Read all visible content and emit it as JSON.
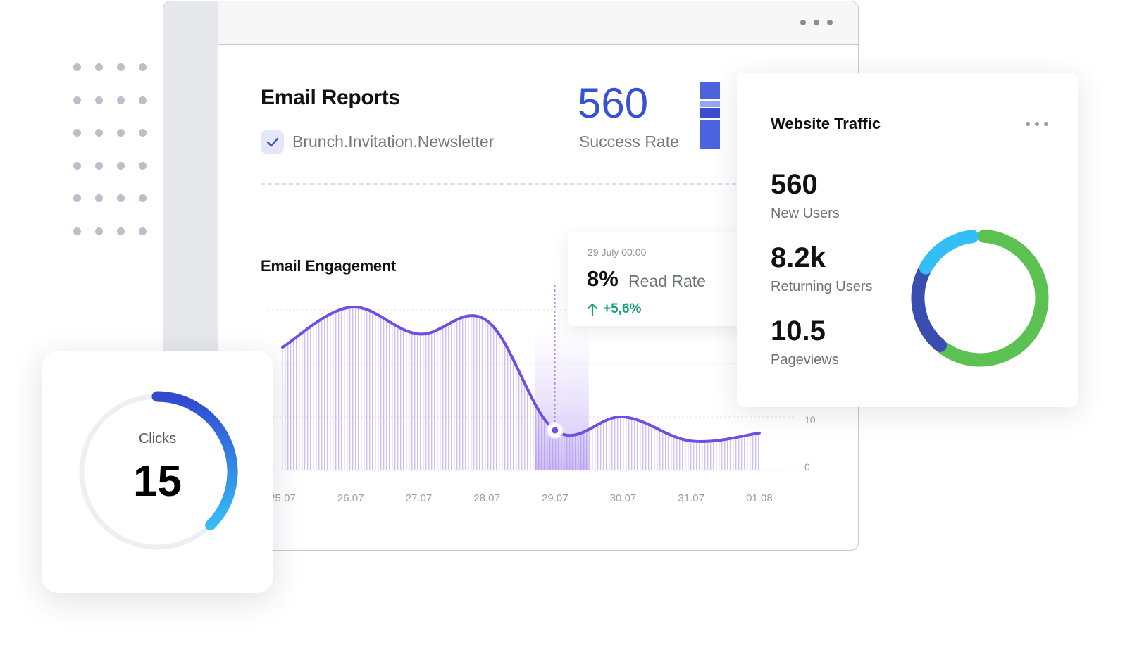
{
  "window": {
    "menu_icon": "more-horizontal-icon"
  },
  "email_reports": {
    "title": "Email Reports",
    "campaign": "Brunch.Invitation.Newsletter",
    "campaign_checked": true,
    "success_value": "560",
    "success_label": "Success Rate",
    "accent": "#3650d6",
    "stack_colors": [
      "#4c63e0",
      "#95a6f1",
      "#3a4fd0",
      "#4c63e0"
    ]
  },
  "engagement": {
    "title": "Email Engagement",
    "tooltip": {
      "date": "29 July 00:00",
      "value": "8%",
      "label": "Read Rate",
      "change": "+5,6%",
      "change_color": "#16a27a",
      "change_icon": "arrow-up-icon"
    }
  },
  "chart_data": {
    "type": "area",
    "categories": [
      "25.07",
      "26.07",
      "27.07",
      "28.07",
      "29.07",
      "30.07",
      "31.07",
      "01.08"
    ],
    "values": [
      23,
      30.5,
      25.5,
      28,
      7.5,
      10,
      5.5,
      7
    ],
    "ylim": [
      0,
      30
    ],
    "y_ticks_visible": [
      "0",
      "10"
    ],
    "grid": true,
    "highlight_category": "29.07",
    "line_color": "#6f4fe0"
  },
  "website_traffic": {
    "title": "Website Traffic",
    "menu_icon": "more-horizontal-icon",
    "stats": [
      {
        "value": "560",
        "label": "New Users"
      },
      {
        "value": "8.2k",
        "label": "Returning Users"
      },
      {
        "value": "10.5",
        "label": "Pageviews"
      }
    ],
    "donut": [
      {
        "share": 0.6,
        "color": "#5bc150"
      },
      {
        "share": 0.22,
        "color": "#3a4db0"
      },
      {
        "share": 0.16,
        "color": "#33bff5"
      }
    ]
  },
  "clicks": {
    "label": "Clicks",
    "value": "15",
    "progress": 0.375,
    "gradient": [
      "#3248cf",
      "#35bdf7"
    ],
    "track_color": "#eeeff2"
  }
}
